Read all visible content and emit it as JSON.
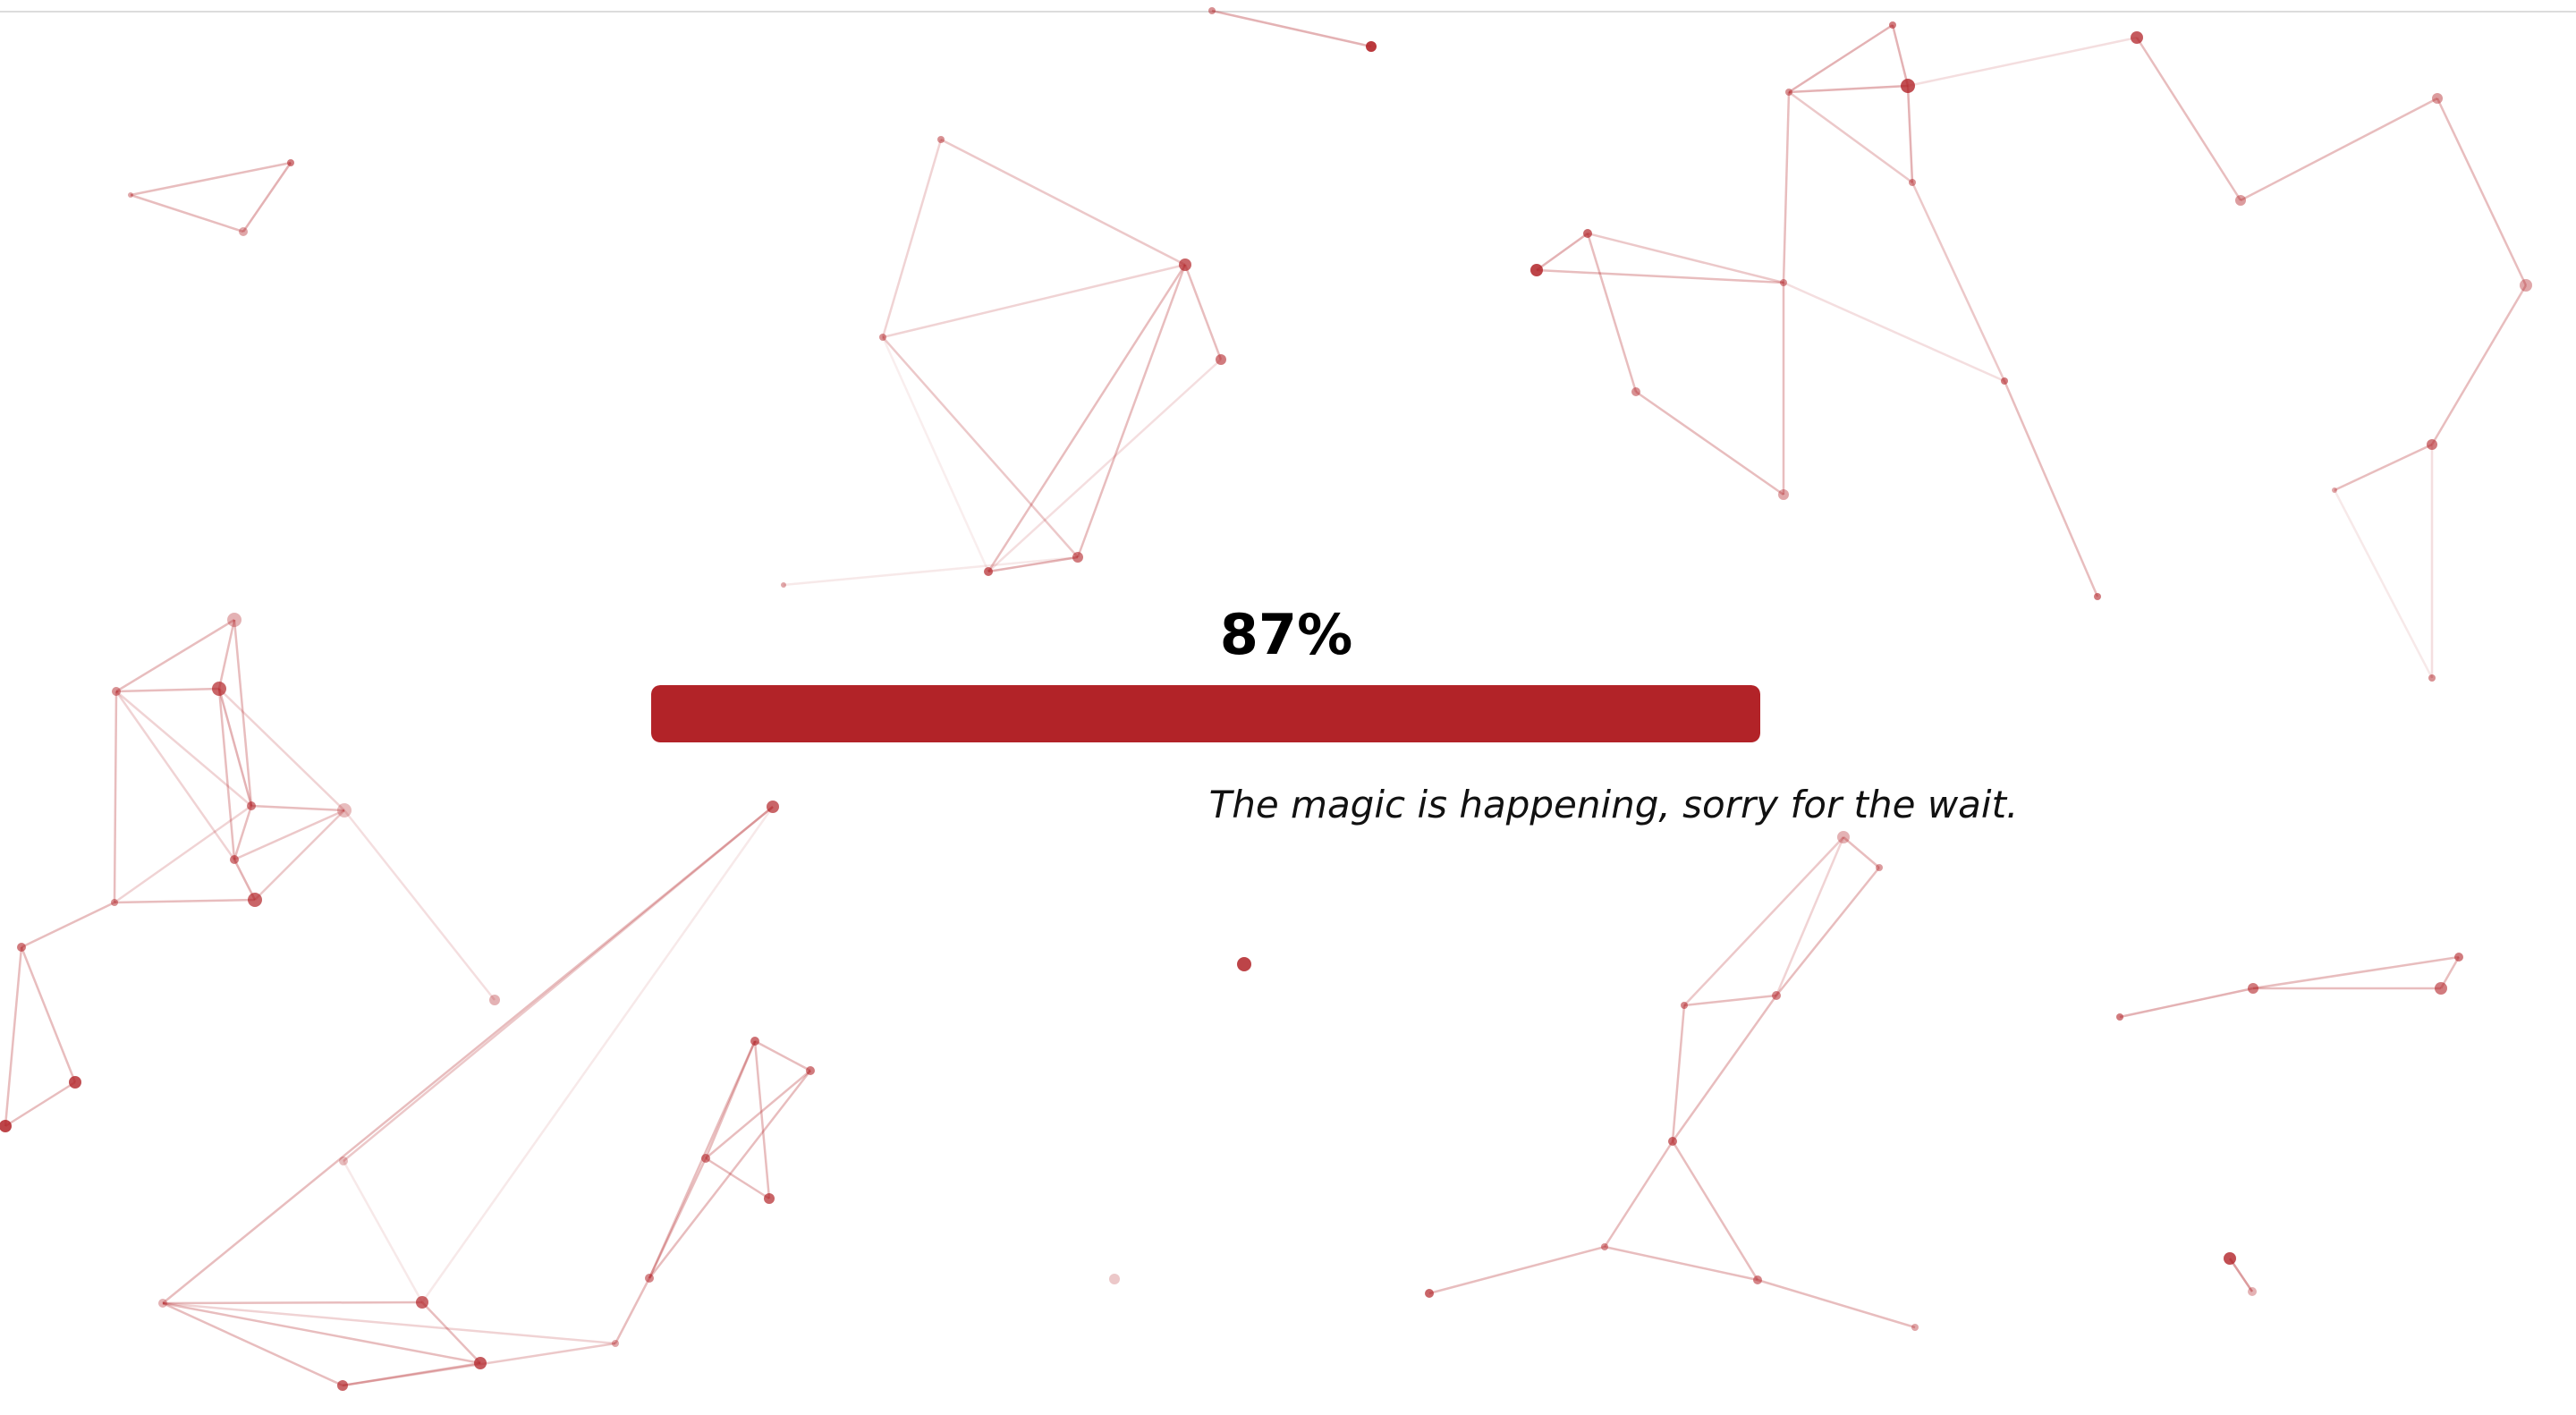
{
  "loader": {
    "percent_label": "87%",
    "progress": 1.0,
    "message": "The magic is happening, sorry for the wait."
  },
  "colors": {
    "accent": "#b22328",
    "background": "#ffffff",
    "text": "#000000"
  },
  "background": {
    "style": "particle-network"
  }
}
